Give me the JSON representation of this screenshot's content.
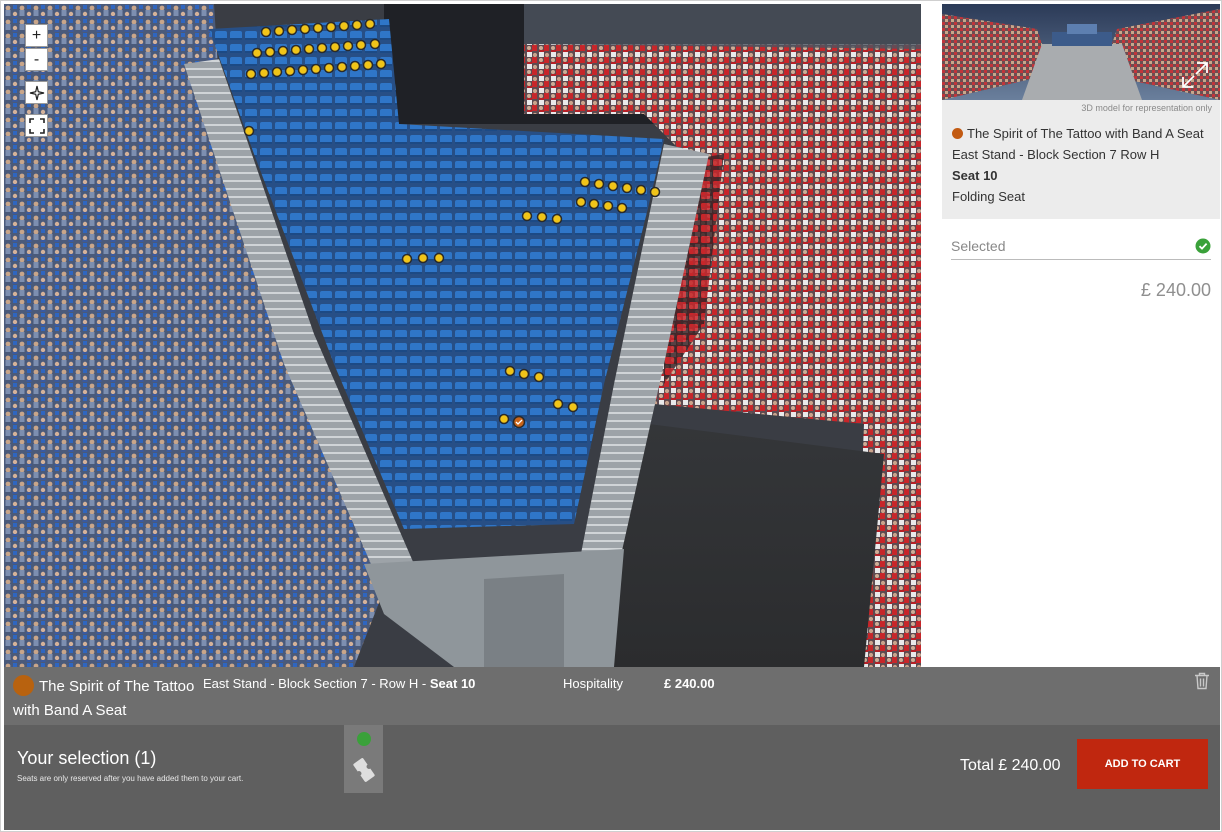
{
  "viewer": {
    "controls": {
      "zoom_in": "+",
      "zoom_out": "-"
    },
    "colors": {
      "available_seat": "#f0c419",
      "selected_seat": "#b8620f",
      "block_seat": "#2f76c8",
      "other_stand_seat": "#c7262a"
    }
  },
  "panel": {
    "preview_note": "3D model for representation only",
    "event_title": "The Spirit of The Tattoo with Band A Seat",
    "location": "East Stand - Block Section 7 Row H",
    "seat": "Seat 10",
    "seat_type": "Folding Seat",
    "status": "Selected",
    "price": "£ 240.00"
  },
  "selection_row": {
    "title": "The Spirit of The Tattoo with Band A Seat",
    "location": "East Stand - Block Section 7 - Row H - ",
    "seat": "Seat 10",
    "category": "Hospitality",
    "price": "£ 240.00"
  },
  "bottom": {
    "selection_title": "Your selection (1)",
    "note": "Seats are only reserved after you have added them to your cart.",
    "total": "Total £ 240.00",
    "add_to_cart": "ADD TO CART"
  }
}
